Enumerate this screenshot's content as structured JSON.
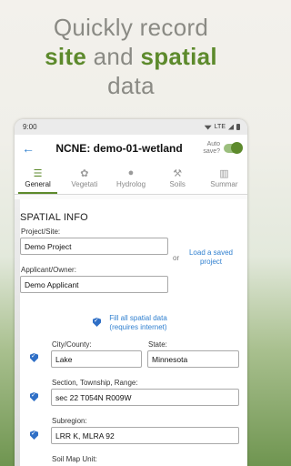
{
  "promo": {
    "line1": "Quickly record",
    "site": "site",
    "and": " and ",
    "spatial": "spatial",
    "line3": "data"
  },
  "status": {
    "time": "9:00",
    "network": "LTE"
  },
  "appbar": {
    "title": "NCNE: demo-01-wetland",
    "autosave_label": "Auto save?"
  },
  "tabs": [
    {
      "label": "General",
      "icon": "list-icon"
    },
    {
      "label": "Vegetati",
      "icon": "leaf-icon"
    },
    {
      "label": "Hydrolog",
      "icon": "drop-icon"
    },
    {
      "label": "Soils",
      "icon": "shovel-icon"
    },
    {
      "label": "Summar",
      "icon": "clipboard-icon"
    }
  ],
  "form": {
    "section_title": "SPATIAL INFO",
    "project_label": "Project/Site:",
    "project_value": "Demo Project",
    "or": "or",
    "load_link": "Load a saved project",
    "applicant_label": "Applicant/Owner:",
    "applicant_value": "Demo Applicant",
    "fill_link_1": "Fill all spatial data",
    "fill_link_2": "(requires internet)",
    "city_label": "City/County:",
    "city_value": "Lake",
    "state_label": "State:",
    "state_value": "Minnesota",
    "str_label": "Section, Township, Range:",
    "str_value": "sec 22 T054N R009W",
    "subregion_label": "Subregion:",
    "subregion_value": "LRR K, MLRA 92",
    "soilmap_label": "Soil Map Unit:"
  }
}
